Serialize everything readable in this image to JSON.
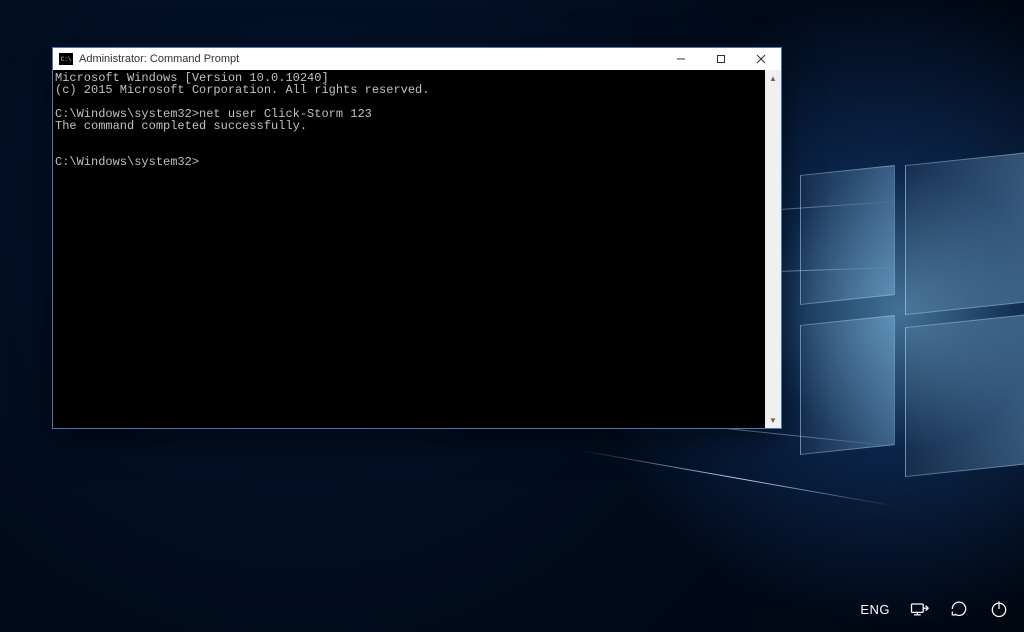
{
  "window": {
    "title": "Administrator: Command Prompt"
  },
  "terminal": {
    "lines": [
      "Microsoft Windows [Version 10.0.10240]",
      "(c) 2015 Microsoft Corporation. All rights reserved.",
      "",
      "C:\\Windows\\system32>net user Click-Storm 123",
      "The command completed successfully.",
      "",
      "",
      "C:\\Windows\\system32>"
    ]
  },
  "tray": {
    "language": "ENG"
  }
}
